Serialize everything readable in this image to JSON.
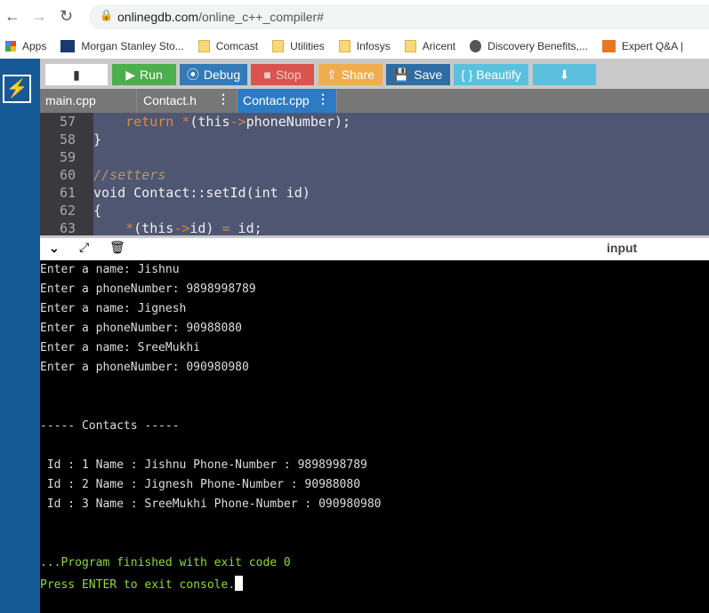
{
  "browser": {
    "url_host": "onlinegdb.com",
    "url_path": "/online_c++_compiler#",
    "bookmarks": [
      {
        "label": "Apps",
        "icon": "apps-grid-icon"
      },
      {
        "label": "Morgan Stanley Sto...",
        "icon": "ms-icon",
        "badge": "MS"
      },
      {
        "label": "Comcast",
        "icon": "folder-icon"
      },
      {
        "label": "Utilities",
        "icon": "folder-icon"
      },
      {
        "label": "Infosys",
        "icon": "folder-icon"
      },
      {
        "label": "Aricent",
        "icon": "folder-icon"
      },
      {
        "label": "Discovery Benefits,...",
        "icon": "globe-icon"
      },
      {
        "label": "Expert Q&A |",
        "icon": "chegg-icon",
        "badge": "C"
      }
    ]
  },
  "toolbar": {
    "run": "Run",
    "debug": "Debug",
    "stop": "Stop",
    "share": "Share",
    "save": "Save",
    "beautify": "{ } Beautify"
  },
  "colors": {
    "run": "#4cae4c",
    "debug": "#337ab7",
    "stop": "#d9534f",
    "share": "#f0ad4e",
    "save": "#2e6da4",
    "beautify": "#5bc0de",
    "sidebar": "#155a96"
  },
  "tabs": [
    {
      "label": "main.cpp"
    },
    {
      "label": "Contact.h"
    },
    {
      "label": "Contact.cpp",
      "active": true
    }
  ],
  "code": {
    "line_numbers": [
      "57",
      "58",
      "59",
      "60",
      "61",
      "62",
      "63"
    ],
    "lines": [
      [
        {
          "t": "    "
        },
        {
          "t": "return",
          "c": "kw"
        },
        {
          "t": " "
        },
        {
          "t": "*",
          "c": "op"
        },
        {
          "t": "(this"
        },
        {
          "t": "->",
          "c": "op"
        },
        {
          "t": "phoneNumber);"
        }
      ],
      [
        {
          "t": "}"
        }
      ],
      [
        {
          "t": ""
        }
      ],
      [
        {
          "t": "//setters",
          "c": "cm"
        }
      ],
      [
        {
          "t": "void Contact::setId(int id)"
        }
      ],
      [
        {
          "t": "{"
        }
      ],
      [
        {
          "t": "    "
        },
        {
          "t": "*",
          "c": "op"
        },
        {
          "t": "(this"
        },
        {
          "t": "->",
          "c": "op"
        },
        {
          "t": "id) "
        },
        {
          "t": "=",
          "c": "op"
        },
        {
          "t": " id;"
        }
      ]
    ]
  },
  "console": {
    "input_label": "input",
    "lines": [
      "Enter a name: Jishnu",
      "Enter a phoneNumber: 9898998789",
      "Enter a name: Jignesh",
      "Enter a phoneNumber: 90988080",
      "Enter a name: SreeMukhi",
      "Enter a phoneNumber: 090980980",
      "",
      "",
      "----- Contacts -----",
      "",
      " Id : 1 Name : Jishnu Phone-Number : 9898998789",
      " Id : 2 Name : Jignesh Phone-Number : 90988080",
      " Id : 3 Name : SreeMukhi Phone-Number : 090980980",
      "",
      ""
    ],
    "finished": "...Program finished with exit code 0",
    "press_enter": "Press ENTER to exit console."
  }
}
